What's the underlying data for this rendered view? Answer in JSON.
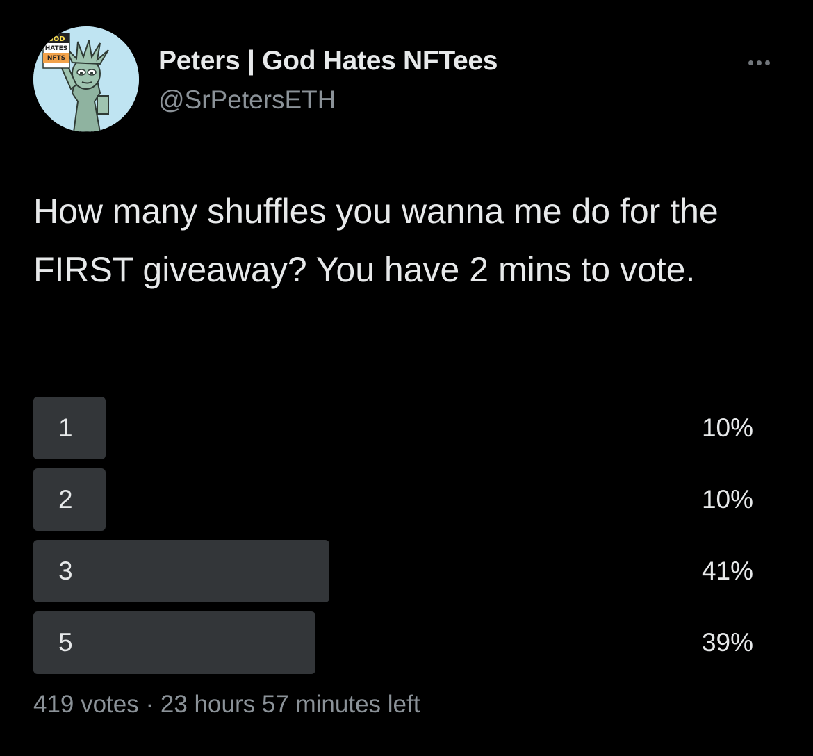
{
  "author": {
    "display_name": "Peters | God Hates NFTees",
    "handle": "@SrPetersETH",
    "avatar_icon": "statue-of-liberty-avatar-icon",
    "avatar_sign_lines": [
      "GOD",
      "HATES",
      "NFTS"
    ]
  },
  "tweet": {
    "text": "How many shuffles you wanna me do for the FIRST giveaway? You have 2 mins to vote."
  },
  "poll": {
    "options": [
      {
        "label": "1",
        "percent": "10%",
        "fraction": 0.1
      },
      {
        "label": "2",
        "percent": "10%",
        "fraction": 0.1
      },
      {
        "label": "3",
        "percent": "41%",
        "fraction": 0.41
      },
      {
        "label": "5",
        "percent": "39%",
        "fraction": 0.39
      }
    ],
    "votes": "419 votes",
    "separator": "·",
    "time_left": "23 hours 57 minutes left"
  },
  "colors": {
    "background": "#000000",
    "bar": "#333639",
    "text": "#e7e9ea",
    "secondary_text": "#8b9298",
    "avatar_bg": "#bfe4f2"
  }
}
